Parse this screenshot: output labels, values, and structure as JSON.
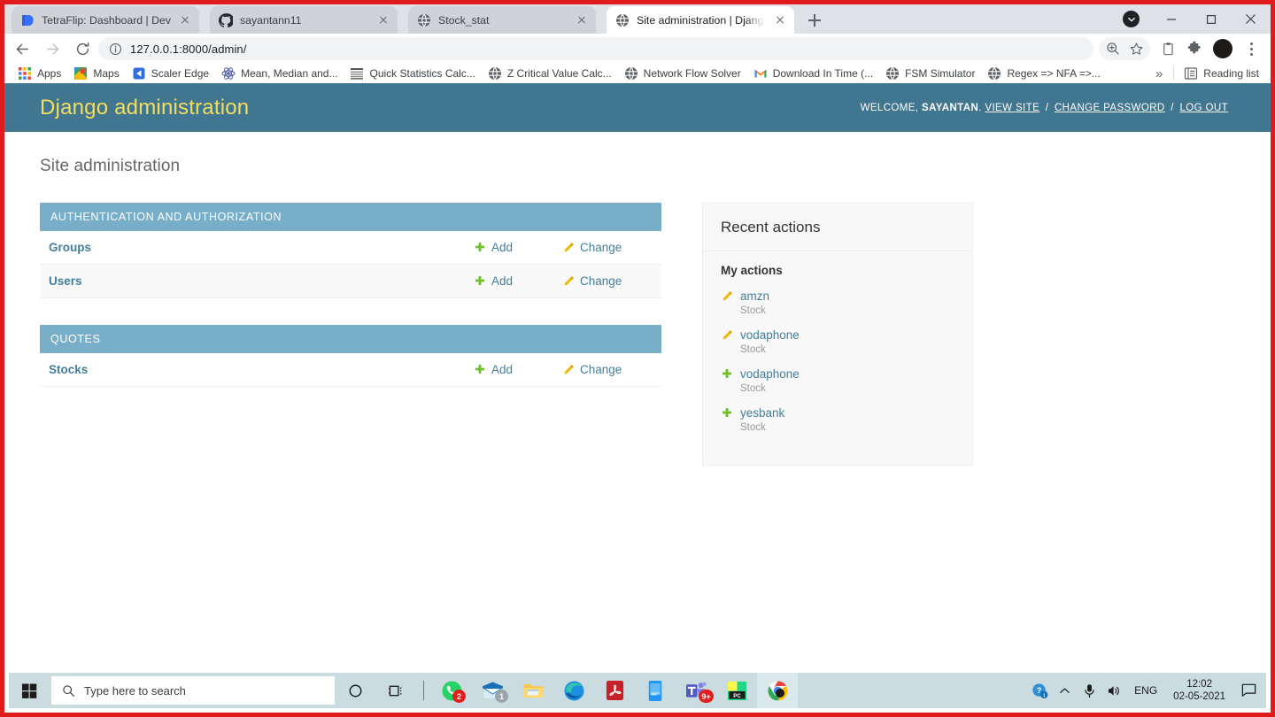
{
  "browser": {
    "tabs": [
      {
        "title": "TetraFlip: Dashboard | Devfolio",
        "favicon": "devfolio-icon",
        "active": false
      },
      {
        "title": "sayantann11",
        "favicon": "github-icon",
        "active": false
      },
      {
        "title": "Stock_stat",
        "favicon": "globe-icon",
        "active": false
      },
      {
        "title": "Site administration | Django site a",
        "favicon": "globe-icon",
        "active": true
      }
    ],
    "new_tab_label": "+",
    "window_controls": {
      "minimize": "—",
      "maximize": "❐",
      "close": "✕"
    },
    "nav": {
      "back": "←",
      "forward": "→",
      "reload": "⟳"
    },
    "omnibox": {
      "url": "127.0.0.1:8000/admin/",
      "info_icon": "info-circle-icon"
    },
    "toolbar_icons": [
      "zoom-icon",
      "bookmark-star-icon",
      "clipboard-extension-icon",
      "extensions-puzzle-icon",
      "profile-avatar",
      "kebab-menu-icon"
    ],
    "bookmarks": [
      {
        "label": "Apps",
        "icon": "apps-grid-icon"
      },
      {
        "label": "Maps",
        "icon": "google-maps-icon"
      },
      {
        "label": "Scaler Edge",
        "icon": "scaler-icon"
      },
      {
        "label": "Mean, Median and...",
        "icon": "atom-icon"
      },
      {
        "label": "Quick Statistics Calc...",
        "icon": "list-icon"
      },
      {
        "label": "Z Critical Value Calc...",
        "icon": "globe-icon"
      },
      {
        "label": "Network Flow Solver",
        "icon": "globe-icon"
      },
      {
        "label": "Download In Time (...",
        "icon": "gmail-icon"
      },
      {
        "label": "FSM Simulator",
        "icon": "globe-icon"
      },
      {
        "label": "Regex => NFA =>...",
        "icon": "globe-icon"
      }
    ],
    "bookmarks_overflow": "»",
    "reading_list": {
      "label": "Reading list",
      "icon": "reading-list-icon"
    }
  },
  "django": {
    "branding": "Django administration",
    "usertools": {
      "welcome": "WELCOME,",
      "username": "SAYANTAN",
      "period": ".",
      "view_site": "VIEW SITE",
      "change_password": "CHANGE PASSWORD",
      "log_out": "LOG OUT",
      "separator": "/"
    },
    "content_title": "Site administration",
    "add_label": "Add",
    "change_label": "Change",
    "modules": [
      {
        "caption": "AUTHENTICATION AND AUTHORIZATION",
        "models": [
          {
            "name": "Groups"
          },
          {
            "name": "Users"
          }
        ]
      },
      {
        "caption": "QUOTES",
        "models": [
          {
            "name": "Stocks"
          }
        ]
      }
    ],
    "recent_actions": {
      "title": "Recent actions",
      "subtitle": "My actions",
      "items": [
        {
          "name": "amzn",
          "model": "Stock",
          "type": "change"
        },
        {
          "name": "vodaphone",
          "model": "Stock",
          "type": "change"
        },
        {
          "name": "vodaphone",
          "model": "Stock",
          "type": "add"
        },
        {
          "name": "yesbank",
          "model": "Stock",
          "type": "add"
        }
      ]
    },
    "colors": {
      "header_bg": "#417690",
      "branding_text": "#f5dd5d",
      "module_caption_bg": "#79aec8",
      "link": "#447e9b",
      "add_icon": "#70bf2b",
      "change_icon": "#efb80b"
    }
  },
  "taskbar": {
    "start": "windows-logo",
    "search_placeholder": "Type here to search",
    "buttons": [
      {
        "name": "cortana-icon",
        "badge": ""
      },
      {
        "name": "task-view-icon",
        "badge": ""
      },
      {
        "name": "whatsapp-icon",
        "badge": "2"
      },
      {
        "name": "mail-icon",
        "badge": "1"
      },
      {
        "name": "file-explorer-icon",
        "badge": ""
      },
      {
        "name": "microsoft-edge-icon",
        "badge": ""
      },
      {
        "name": "adobe-acrobat-icon",
        "badge": ""
      },
      {
        "name": "your-phone-icon",
        "badge": ""
      },
      {
        "name": "microsoft-teams-icon",
        "badge": "9+"
      },
      {
        "name": "pycharm-icon",
        "badge": ""
      },
      {
        "name": "google-chrome-icon",
        "badge": ""
      }
    ],
    "tray": {
      "help_icon": "help-circle-icon",
      "chevron_up": "⌃",
      "mic_icon": "microphone-icon",
      "volume_icon": "speaker-icon",
      "language": "ENG",
      "time": "12:02",
      "date": "02-05-2021",
      "notifications_icon": "notification-icon"
    }
  }
}
